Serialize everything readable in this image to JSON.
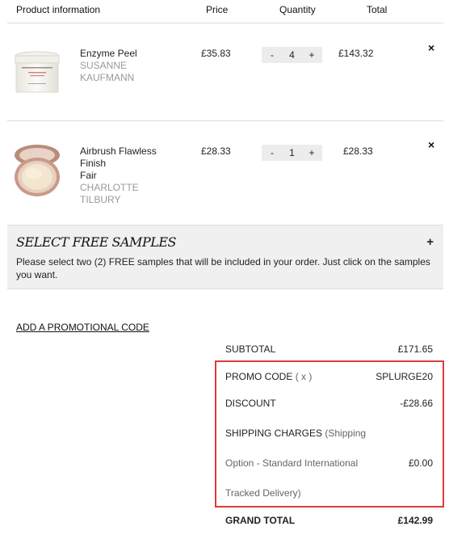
{
  "headers": {
    "product": "Product information",
    "price": "Price",
    "quantity": "Quantity",
    "total": "Total"
  },
  "items": [
    {
      "name": "Enzyme Peel",
      "brand_line1": "SUSANNE",
      "brand_line2": "KAUFMANN",
      "price": "£35.83",
      "qty": "4",
      "total": "£143.32",
      "minus": "-",
      "plus": "+",
      "remove": "×"
    },
    {
      "name_line1": "Airbrush Flawless",
      "name_line2": "Finish",
      "variant": "Fair",
      "brand_line1": "CHARLOTTE",
      "brand_line2": "TILBURY",
      "price": "£28.33",
      "qty": "1",
      "total": "£28.33",
      "minus": "-",
      "plus": "+",
      "remove": "×"
    }
  ],
  "samples": {
    "title": "SELECT FREE SAMPLES",
    "text": "Please select two (2) FREE samples that will be included in your order. Just click on the samples you want.",
    "toggle": "+"
  },
  "promo_link": "ADD A PROMOTIONAL CODE",
  "summary": {
    "subtotal_label": "SUBTOTAL",
    "subtotal_value": "£171.65",
    "promo_label": "PROMO CODE",
    "promo_remove": "( x )",
    "promo_value": "SPLURGE20",
    "discount_label": "DISCOUNT",
    "discount_value": "-£28.66",
    "shipping_label": "SHIPPING CHARGES",
    "shipping_note_1": "(Shipping",
    "shipping_note_2": "Option - Standard International",
    "shipping_note_3": "Tracked Delivery)",
    "shipping_value": "£0.00",
    "grand_label": "GRAND TOTAL",
    "grand_value": "£142.99"
  },
  "colors": {
    "highlight_border": "#e03a3a",
    "samples_bg": "#f0f0f0",
    "qty_bg": "#ececec",
    "brand_gray": "#999999"
  },
  "icons": {
    "remove": "close-icon",
    "expand": "plus-icon"
  }
}
